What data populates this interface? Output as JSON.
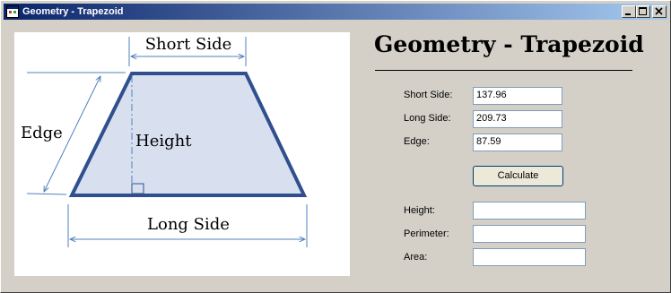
{
  "window": {
    "title": "Geometry - Trapezoid",
    "icon": "app-window-icon",
    "controls": [
      "minimize-icon",
      "maximize-icon",
      "close-icon"
    ]
  },
  "diagram": {
    "short_side": "Short Side",
    "long_side": "Long Side",
    "edge": "Edge",
    "height": "Height",
    "fill_color": "#d8e0f0",
    "stroke_color": "#2f4f8f",
    "dimension_color": "#4f81bd"
  },
  "heading": "Geometry - Trapezoid",
  "inputs": {
    "short_side": {
      "label": "Short Side:",
      "value": "137.96"
    },
    "long_side": {
      "label": "Long Side:",
      "value": "209.73"
    },
    "edge": {
      "label": "Edge:",
      "value": "87.59"
    }
  },
  "calculate_label": "Calculate",
  "results": {
    "height": {
      "label": "Height:",
      "value": ""
    },
    "perimeter": {
      "label": "Perimeter:",
      "value": ""
    },
    "area": {
      "label": "Area:",
      "value": ""
    }
  }
}
